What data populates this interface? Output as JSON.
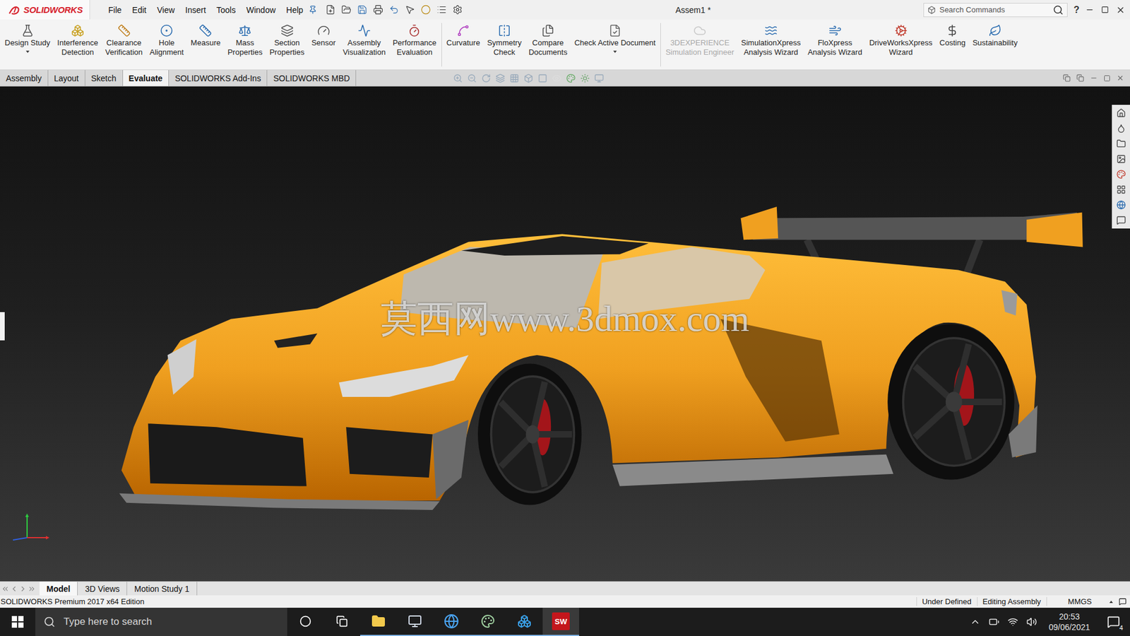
{
  "app": {
    "logo": "SOLIDWORKS",
    "menus": [
      "File",
      "Edit",
      "View",
      "Insert",
      "Tools",
      "Window",
      "Help"
    ],
    "title": "Assem1 *",
    "search": {
      "placeholder": "Search Commands"
    },
    "help": "?"
  },
  "ribbon": [
    {
      "lines": [
        "Design Study"
      ],
      "dropdown": true,
      "disabled": false
    },
    {
      "lines": [
        "Interference",
        "Detection"
      ],
      "dropdown": false,
      "disabled": false
    },
    {
      "lines": [
        "Clearance",
        "Verification"
      ],
      "dropdown": false,
      "disabled": false
    },
    {
      "lines": [
        "Hole",
        "Alignment"
      ],
      "dropdown": false,
      "disabled": false
    },
    {
      "lines": [
        "Measure"
      ],
      "dropdown": false,
      "disabled": false
    },
    {
      "lines": [
        "Mass",
        "Properties"
      ],
      "dropdown": false,
      "disabled": false
    },
    {
      "lines": [
        "Section",
        "Properties"
      ],
      "dropdown": false,
      "disabled": false
    },
    {
      "lines": [
        "Sensor"
      ],
      "dropdown": false,
      "disabled": false
    },
    {
      "lines": [
        "Assembly",
        "Visualization"
      ],
      "dropdown": false,
      "disabled": false
    },
    {
      "lines": [
        "Performance",
        "Evaluation"
      ],
      "dropdown": false,
      "disabled": false
    },
    {
      "lines": [
        "Curvature"
      ],
      "dropdown": false,
      "disabled": false
    },
    {
      "lines": [
        "Symmetry",
        "Check"
      ],
      "dropdown": false,
      "disabled": false
    },
    {
      "lines": [
        "Compare",
        "Documents"
      ],
      "dropdown": false,
      "disabled": false
    },
    {
      "lines": [
        "Check Active Document"
      ],
      "dropdown": true,
      "disabled": false
    },
    {
      "lines": [
        "3DEXPERIENCE",
        "Simulation Engineer"
      ],
      "dropdown": false,
      "disabled": true
    },
    {
      "lines": [
        "SimulationXpress",
        "Analysis Wizard"
      ],
      "dropdown": false,
      "disabled": false
    },
    {
      "lines": [
        "FloXpress",
        "Analysis Wizard"
      ],
      "dropdown": false,
      "disabled": false
    },
    {
      "lines": [
        "DriveWorksXpress",
        "Wizard"
      ],
      "dropdown": false,
      "disabled": false
    },
    {
      "lines": [
        "Costing"
      ],
      "dropdown": false,
      "disabled": false
    },
    {
      "lines": [
        "Sustainability"
      ],
      "dropdown": false,
      "disabled": false
    }
  ],
  "tabs": [
    {
      "label": "Assembly",
      "selected": false
    },
    {
      "label": "Layout",
      "selected": false
    },
    {
      "label": "Sketch",
      "selected": false
    },
    {
      "label": "Evaluate",
      "selected": true
    },
    {
      "label": "SOLIDWORKS Add-Ins",
      "selected": false
    },
    {
      "label": "SOLIDWORKS MBD",
      "selected": false
    }
  ],
  "viewport": {
    "watermark": "莫西网www.3dmox.com"
  },
  "bottom_tabs": [
    {
      "label": "Model",
      "selected": true
    },
    {
      "label": "3D Views",
      "selected": false
    },
    {
      "label": "Motion Study 1",
      "selected": false
    }
  ],
  "status_bar": {
    "edition": "SOLIDWORKS Premium 2017 x64 Edition",
    "items": [
      "Under Defined",
      "Editing Assembly"
    ],
    "units": "MMGS"
  },
  "taskbar": {
    "search_placeholder": "Type here to search",
    "active_app_label": "SW",
    "time": "20:53",
    "date": "09/06/2021",
    "notifications": "4"
  }
}
